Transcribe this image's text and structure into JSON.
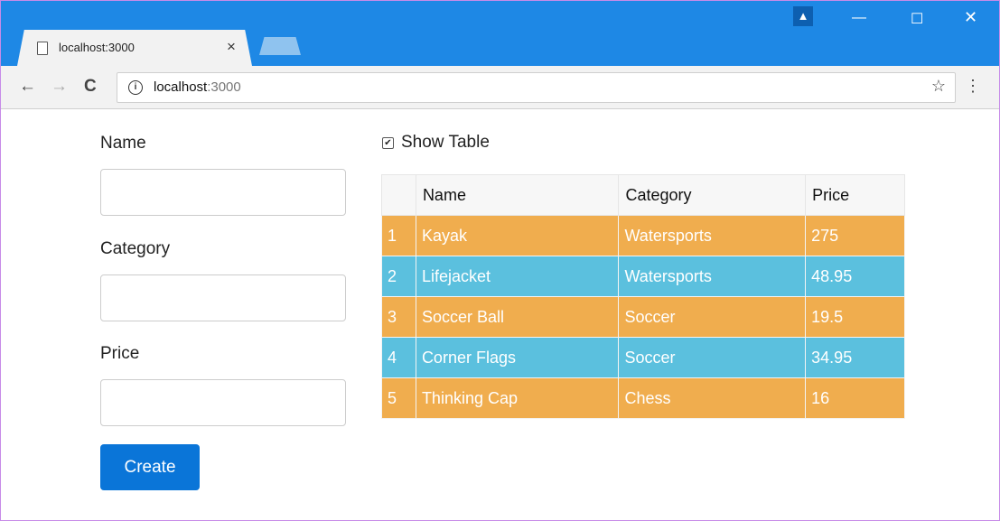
{
  "browser": {
    "tab_title": "localhost:3000",
    "tab_close": "×",
    "url_host": "localhost",
    "url_port": ":3000",
    "icons": [
      "page-icon",
      "back-icon",
      "forward-icon",
      "reload-icon",
      "info-icon",
      "star-icon",
      "menu-icon",
      "profile-icon",
      "minimize-icon",
      "maximize-icon",
      "close-icon"
    ],
    "accent_color": "#1e88e5"
  },
  "form": {
    "name_label": "Name",
    "name_value": "",
    "category_label": "Category",
    "category_value": "",
    "price_label": "Price",
    "price_value": "",
    "create_label": "Create",
    "button_color": "#0a75d8"
  },
  "table_toggle": {
    "label": "Show Table",
    "checked": true
  },
  "table": {
    "headers": [
      "",
      "Name",
      "Category",
      "Price"
    ],
    "rows": [
      [
        "1",
        "Kayak",
        "Watersports",
        "275"
      ],
      [
        "2",
        "Lifejacket",
        "Watersports",
        "48.95"
      ],
      [
        "3",
        "Soccer Ball",
        "Soccer",
        "19.5"
      ],
      [
        "4",
        "Corner Flags",
        "Soccer",
        "34.95"
      ],
      [
        "5",
        "Thinking Cap",
        "Chess",
        "16"
      ]
    ],
    "row_colors": [
      "#f0ad4e",
      "#5bc0de"
    ]
  }
}
